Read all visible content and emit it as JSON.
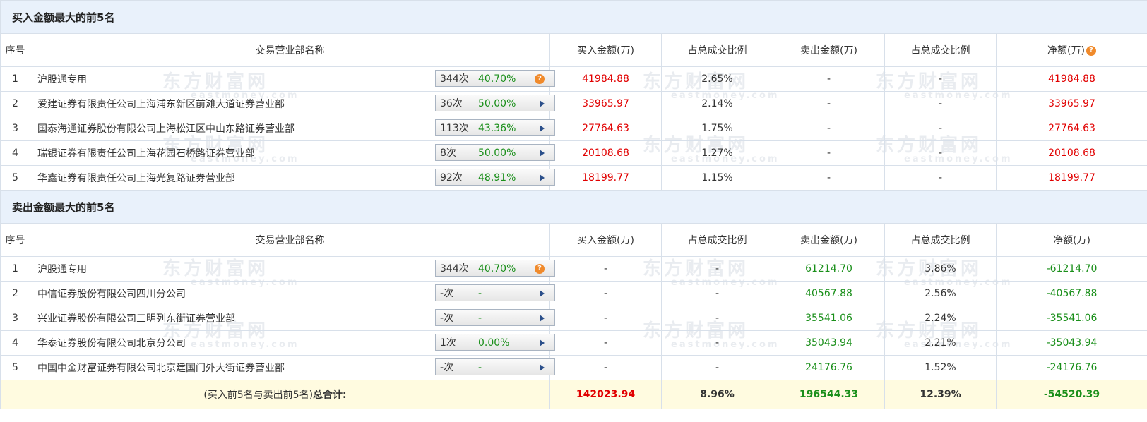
{
  "buy_section": {
    "title": "买入金额最大的前5名",
    "headers": [
      "序号",
      "交易营业部名称",
      "买入金额(万)",
      "占总成交比例",
      "卖出金额(万)",
      "占总成交比例",
      "净额(万)"
    ],
    "rows": [
      {
        "idx": "1",
        "name": "沪股通专用",
        "count": "344次",
        "pct": "40.70%",
        "buy": "41984.88",
        "buy_ratio": "2.65%",
        "sell": "-",
        "sell_ratio": "-",
        "net": "41984.88",
        "icon": "question-icon"
      },
      {
        "idx": "2",
        "name": "爱建证券有限责任公司上海浦东新区前滩大道证券营业部",
        "count": "36次",
        "pct": "50.00%",
        "buy": "33965.97",
        "buy_ratio": "2.14%",
        "sell": "-",
        "sell_ratio": "-",
        "net": "33965.97",
        "icon": "arrow-right-icon"
      },
      {
        "idx": "3",
        "name": "国泰海通证券股份有限公司上海松江区中山东路证券营业部",
        "count": "113次",
        "pct": "43.36%",
        "buy": "27764.63",
        "buy_ratio": "1.75%",
        "sell": "-",
        "sell_ratio": "-",
        "net": "27764.63",
        "icon": "arrow-right-icon"
      },
      {
        "idx": "4",
        "name": "瑞银证券有限责任公司上海花园石桥路证券营业部",
        "count": "8次",
        "pct": "50.00%",
        "buy": "20108.68",
        "buy_ratio": "1.27%",
        "sell": "-",
        "sell_ratio": "-",
        "net": "20108.68",
        "icon": "arrow-right-icon"
      },
      {
        "idx": "5",
        "name": "华鑫证券有限责任公司上海光复路证券营业部",
        "count": "92次",
        "pct": "48.91%",
        "buy": "18199.77",
        "buy_ratio": "1.15%",
        "sell": "-",
        "sell_ratio": "-",
        "net": "18199.77",
        "icon": "arrow-right-icon"
      }
    ]
  },
  "sell_section": {
    "title": "卖出金额最大的前5名",
    "headers": [
      "序号",
      "交易营业部名称",
      "买入金额(万)",
      "占总成交比例",
      "卖出金额(万)",
      "占总成交比例",
      "净额(万)"
    ],
    "rows": [
      {
        "idx": "1",
        "name": "沪股通专用",
        "count": "344次",
        "pct": "40.70%",
        "buy": "-",
        "buy_ratio": "-",
        "sell": "61214.70",
        "sell_ratio": "3.86%",
        "net": "-61214.70",
        "icon": "question-icon"
      },
      {
        "idx": "2",
        "name": "中信证券股份有限公司四川分公司",
        "count": "-次",
        "pct": "-",
        "buy": "-",
        "buy_ratio": "-",
        "sell": "40567.88",
        "sell_ratio": "2.56%",
        "net": "-40567.88",
        "icon": "arrow-right-icon"
      },
      {
        "idx": "3",
        "name": "兴业证券股份有限公司三明列东街证券营业部",
        "count": "-次",
        "pct": "-",
        "buy": "-",
        "buy_ratio": "-",
        "sell": "35541.06",
        "sell_ratio": "2.24%",
        "net": "-35541.06",
        "icon": "arrow-right-icon"
      },
      {
        "idx": "4",
        "name": "华泰证券股份有限公司北京分公司",
        "count": "1次",
        "pct": "0.00%",
        "buy": "-",
        "buy_ratio": "-",
        "sell": "35043.94",
        "sell_ratio": "2.21%",
        "net": "-35043.94",
        "icon": "arrow-right-icon"
      },
      {
        "idx": "5",
        "name": "中国中金财富证券有限公司北京建国门外大街证券营业部",
        "count": "-次",
        "pct": "-",
        "buy": "-",
        "buy_ratio": "-",
        "sell": "24176.76",
        "sell_ratio": "1.52%",
        "net": "-24176.76",
        "icon": "arrow-right-icon"
      }
    ]
  },
  "total": {
    "label_prefix": "(买入前5名与卖出前5名)",
    "label_suffix": "总合计:",
    "buy": "142023.94",
    "buy_ratio": "8.96%",
    "sell": "196544.33",
    "sell_ratio": "12.39%",
    "net": "-54520.39"
  },
  "watermark": {
    "cn": "东方财富网",
    "en": "eastmoney.com"
  },
  "colors": {
    "positive": "#e10000",
    "negative": "#1a8f1a",
    "section_bg": "#e9f1fb",
    "total_bg": "#fffbe0",
    "icon_orange": "#f08a2b",
    "arrow_blue": "#2b4f8a"
  }
}
